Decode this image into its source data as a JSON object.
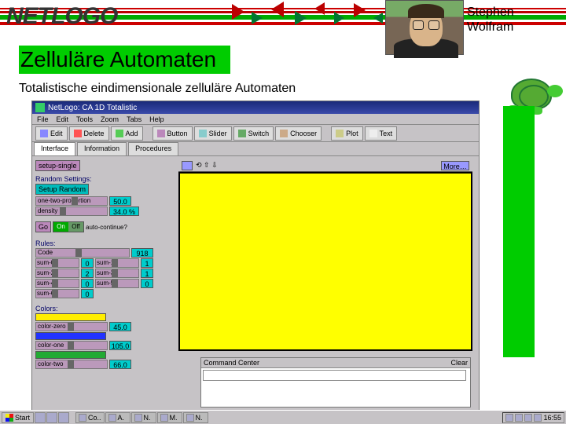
{
  "banner": {
    "logo_text": "NETLOGO"
  },
  "attribution": {
    "line1": "Stephen",
    "line2": "Wolfram"
  },
  "heading": "Zelluläre Automaten",
  "subheading": "Totalistische eindimensionale zelluläre Automaten",
  "window": {
    "title": "NetLogo: CA 1D Totalistic",
    "menus": [
      "File",
      "Edit",
      "Tools",
      "Zoom",
      "Tabs",
      "Help"
    ],
    "tabs": [
      "Interface",
      "Information",
      "Procedures"
    ],
    "active_tab": 0,
    "toolbar": [
      {
        "name": "edit",
        "label": "Edit"
      },
      {
        "name": "delete",
        "label": "Delete"
      },
      {
        "name": "add",
        "label": "Add"
      },
      {
        "name": "button",
        "label": "Button"
      },
      {
        "name": "slider",
        "label": "Slider"
      },
      {
        "name": "switch",
        "label": "Switch"
      },
      {
        "name": "chooser",
        "label": "Chooser"
      },
      {
        "name": "sep",
        "label": ""
      },
      {
        "name": "plot",
        "label": "Plot"
      },
      {
        "name": "text",
        "label": "Text"
      }
    ],
    "viewbar_center": "⟲ ⇧ ⇩",
    "viewbar_right": "More…"
  },
  "interface": {
    "setup_button": "setup-single",
    "section_random": "Random Settings:",
    "setup_random_btn": "Setup Random",
    "sliders_top": [
      {
        "name": "one-two-proportion",
        "label": "one-two-proportion",
        "value": "50.0"
      },
      {
        "name": "density",
        "label": "density",
        "value": "34.0 %"
      }
    ],
    "go_button": "Go",
    "auto_switch": {
      "label": "auto-continue?",
      "on": "On",
      "off": "Off"
    },
    "rules_label": "Rules:",
    "code_slider": {
      "label": "Code",
      "value": "918"
    },
    "rule_rows": [
      {
        "l": "sum-0",
        "lv": "0",
        "r": "sum-1",
        "rv": "1"
      },
      {
        "l": "sum-2",
        "lv": "2",
        "r": "sum-3",
        "rv": "1"
      },
      {
        "l": "sum-4",
        "lv": "0",
        "r": "sum-5",
        "rv": "0"
      },
      {
        "l": "sum-6",
        "lv": "0",
        "r": "",
        "rv": ""
      }
    ],
    "colors_label": "Colors:",
    "color_sliders": [
      {
        "label": "color-zero",
        "value": "45.0",
        "color": "#ffee00"
      },
      {
        "label": "color-one",
        "value": "105.0",
        "color": "#2233ff"
      },
      {
        "label": "color-two",
        "value": "66.0",
        "color": "#22aa33"
      }
    ]
  },
  "command_center": {
    "title": "Command Center",
    "clear": "Clear"
  },
  "taskbar": {
    "start": "Start",
    "tabs": [
      "Co..",
      "A.",
      "N.",
      "M.",
      "N."
    ],
    "clock": "16:55"
  }
}
